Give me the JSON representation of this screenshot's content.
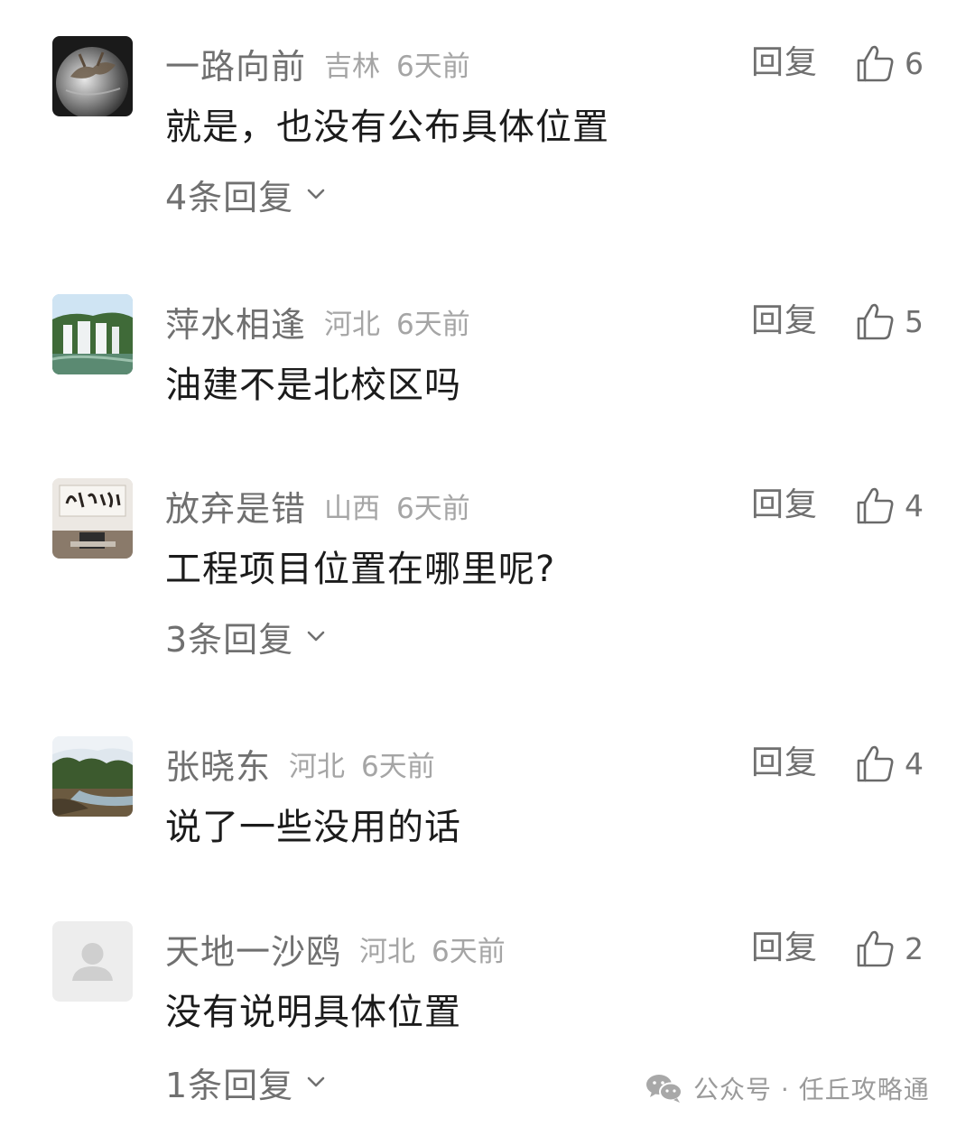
{
  "comments": [
    {
      "username": "一路向前",
      "region": "吉林",
      "time": "6天前",
      "reply_label": "回复",
      "likes": "6",
      "content": "就是，也没有公布具体位置",
      "sub_replies": "4条回复",
      "avatar_icon": "globe-lobster-avatar"
    },
    {
      "username": "萍水相逢",
      "region": "河北",
      "time": "6天前",
      "reply_label": "回复",
      "likes": "5",
      "content": "油建不是北校区吗",
      "sub_replies": "",
      "avatar_icon": "waterfall-avatar"
    },
    {
      "username": "放弃是错",
      "region": "山西",
      "time": "6天前",
      "reply_label": "回复",
      "likes": "4",
      "content": "工程项目位置在哪里呢?",
      "sub_replies": "3条回复",
      "avatar_icon": "office-calligraphy-avatar"
    },
    {
      "username": "张晓东",
      "region": "河北",
      "time": "6天前",
      "reply_label": "回复",
      "likes": "4",
      "content": "说了一些没用的话",
      "sub_replies": "",
      "avatar_icon": "river-landscape-avatar"
    },
    {
      "username": "天地一沙鸥",
      "region": "河北",
      "time": "6天前",
      "reply_label": "回复",
      "likes": "2",
      "content": "没有说明具体位置",
      "sub_replies": "1条回复",
      "avatar_icon": "default-user-avatar"
    }
  ],
  "watermark": {
    "text": "公众号 · 任丘攻略通",
    "icon": "wechat-icon"
  },
  "colors": {
    "name_text": "#707070",
    "meta_text": "#a5a5a5",
    "body_text": "#1b1b1b",
    "background": "#ffffff"
  }
}
